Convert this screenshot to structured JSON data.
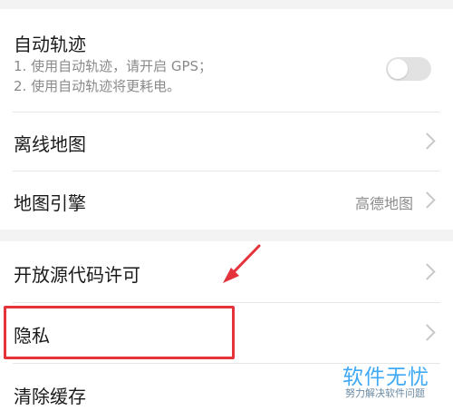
{
  "settings": {
    "auto_track": {
      "label": "自动轨迹",
      "desc_line1": "1. 使用自动轨迹，请开启 GPS；",
      "desc_line2": "2. 使用自动轨迹将更耗电。",
      "toggle_on": false
    },
    "offline_map": {
      "label": "离线地图"
    },
    "map_engine": {
      "label": "地图引擎",
      "value": "高德地图"
    },
    "open_source": {
      "label": "开放源代码许可"
    },
    "privacy": {
      "label": "隐私"
    },
    "clear_cache": {
      "label": "清除缓存"
    }
  },
  "annotation": {
    "highlight_color": "#e5333b"
  },
  "watermark": {
    "title": "软件无忧",
    "subtitle": "努力解决软件问题"
  },
  "colors": {
    "background": "#f3f3f3",
    "card": "#ffffff",
    "text_primary": "#1a1a1a",
    "text_secondary": "#8a8a8a",
    "watermark": "#3fa9f5"
  },
  "icons": {
    "chevron": "chevron-right-icon",
    "arrow": "red-arrow-icon"
  }
}
